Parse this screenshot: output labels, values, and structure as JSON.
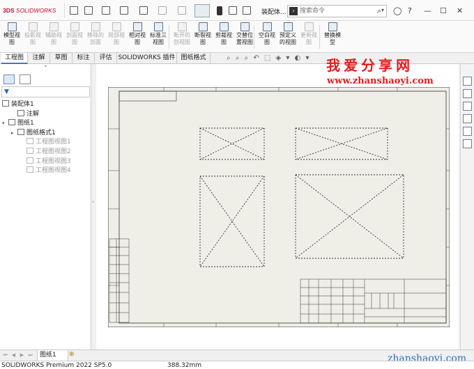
{
  "app": {
    "logo_text": "SOLIDWORKS",
    "document_name": "装配体...",
    "command_search_placeholder": "搜索命令"
  },
  "ribbon": {
    "buttons": [
      {
        "label": "模型视图",
        "enabled": true
      },
      {
        "label": "投影视图",
        "enabled": false
      },
      {
        "label": "辅助视图",
        "enabled": false
      },
      {
        "label": "剖面视图",
        "enabled": false
      },
      {
        "label": "移除的剖面",
        "enabled": false
      },
      {
        "label": "局部视图",
        "enabled": false
      },
      {
        "label": "相对视图",
        "enabled": true
      },
      {
        "label": "标准三视图",
        "enabled": true
      },
      {
        "label": "断开的剖视图",
        "enabled": false
      },
      {
        "label": "断裂视图",
        "enabled": true
      },
      {
        "label": "剪裁视图",
        "enabled": true
      },
      {
        "label": "交替位置视图",
        "enabled": true
      },
      {
        "label": "空白视图",
        "enabled": true
      },
      {
        "label": "预定义的视图",
        "enabled": true
      },
      {
        "label": "更新视图",
        "enabled": false
      },
      {
        "label": "替换模型",
        "enabled": true
      }
    ]
  },
  "tabs": [
    {
      "label": "工程图",
      "active": true
    },
    {
      "label": "注解",
      "active": false
    },
    {
      "label": "草图",
      "active": false
    },
    {
      "label": "标注",
      "active": false
    },
    {
      "label": "评估",
      "active": false
    },
    {
      "label": "SOLIDWORKS 插件",
      "active": false
    },
    {
      "label": "图纸格式",
      "active": false
    }
  ],
  "watermark": {
    "title": "我爱分享网",
    "url": "www.zhanshaoyi.com",
    "bottom_url": "zhanshaoyi.com"
  },
  "tree": {
    "items": [
      {
        "label": "装配体1",
        "indent": 0,
        "arrow": "",
        "dim": false
      },
      {
        "label": "注解",
        "indent": 1,
        "arrow": "",
        "dim": false
      },
      {
        "label": "图纸1",
        "indent": 0,
        "arrow": "▾",
        "dim": false
      },
      {
        "label": "图纸格式1",
        "indent": 1,
        "arrow": "▸",
        "dim": false
      },
      {
        "label": "工程图视图1",
        "indent": 2,
        "arrow": "",
        "dim": true
      },
      {
        "label": "工程图视图2",
        "indent": 2,
        "arrow": "",
        "dim": true
      },
      {
        "label": "工程图视图3",
        "indent": 2,
        "arrow": "",
        "dim": true
      },
      {
        "label": "工程图视图4",
        "indent": 2,
        "arrow": "",
        "dim": true
      }
    ]
  },
  "sheet_tab": {
    "label": "图纸1"
  },
  "status": {
    "version": "SOLIDWORKS Premium 2022 SP5.0",
    "measure": "388.32mm"
  },
  "colors": {
    "accent": "#3a78c3",
    "watermark_red": "#e21d1d",
    "sheet_bg": "#eeeee6"
  }
}
